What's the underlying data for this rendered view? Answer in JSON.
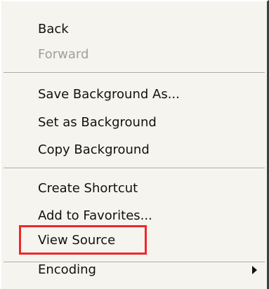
{
  "menu": {
    "items": [
      {
        "label": "Back",
        "enabled": true
      },
      {
        "label": "Forward",
        "enabled": false
      },
      {
        "label": "Save Background As...",
        "enabled": true
      },
      {
        "label": "Set as Background",
        "enabled": true
      },
      {
        "label": "Copy Background",
        "enabled": true
      },
      {
        "label": "Create Shortcut",
        "enabled": true
      },
      {
        "label": "Add to Favorites...",
        "enabled": true
      },
      {
        "label": "View Source",
        "enabled": true,
        "highlighted": true
      },
      {
        "label": "Encoding",
        "enabled": true,
        "has_submenu": true
      }
    ]
  },
  "colors": {
    "menu_background": "#f5f4ee",
    "disabled_text": "#a09f98",
    "highlight_border": "#f0262d"
  },
  "icons": {
    "submenu": "submenu-arrow-icon"
  }
}
